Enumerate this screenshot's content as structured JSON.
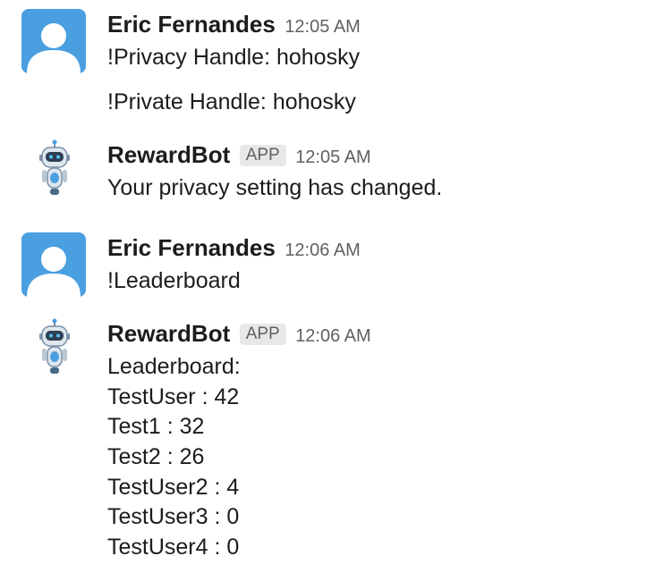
{
  "messages": [
    {
      "user": "Eric Fernandes",
      "time": "12:05 AM",
      "lines": [
        "!Privacy Handle: hohosky",
        "!Private Handle: hohosky"
      ]
    },
    {
      "user": "RewardBot",
      "badge": "APP",
      "time": "12:05 AM",
      "lines": [
        "Your privacy setting has changed."
      ]
    },
    {
      "user": "Eric Fernandes",
      "time": "12:06 AM",
      "lines": [
        "!Leaderboard"
      ]
    },
    {
      "user": "RewardBot",
      "badge": "APP",
      "time": "12:06 AM",
      "lines": [
        "Leaderboard:",
        "TestUser : 42",
        "Test1 : 32",
        "Test2 : 26",
        "TestUser2 : 4",
        "TestUser3 : 0",
        "TestUser4 : 0"
      ]
    }
  ],
  "colors": {
    "avatar_bg": "#4a9fe0",
    "avatar_fg": "#ffffff",
    "badge_bg": "#e8e8e8",
    "text": "#1d1c1d",
    "muted": "#616061"
  },
  "icons": {
    "user_avatar": "default-user-avatar-icon",
    "bot_avatar": "robot-avatar-icon"
  }
}
